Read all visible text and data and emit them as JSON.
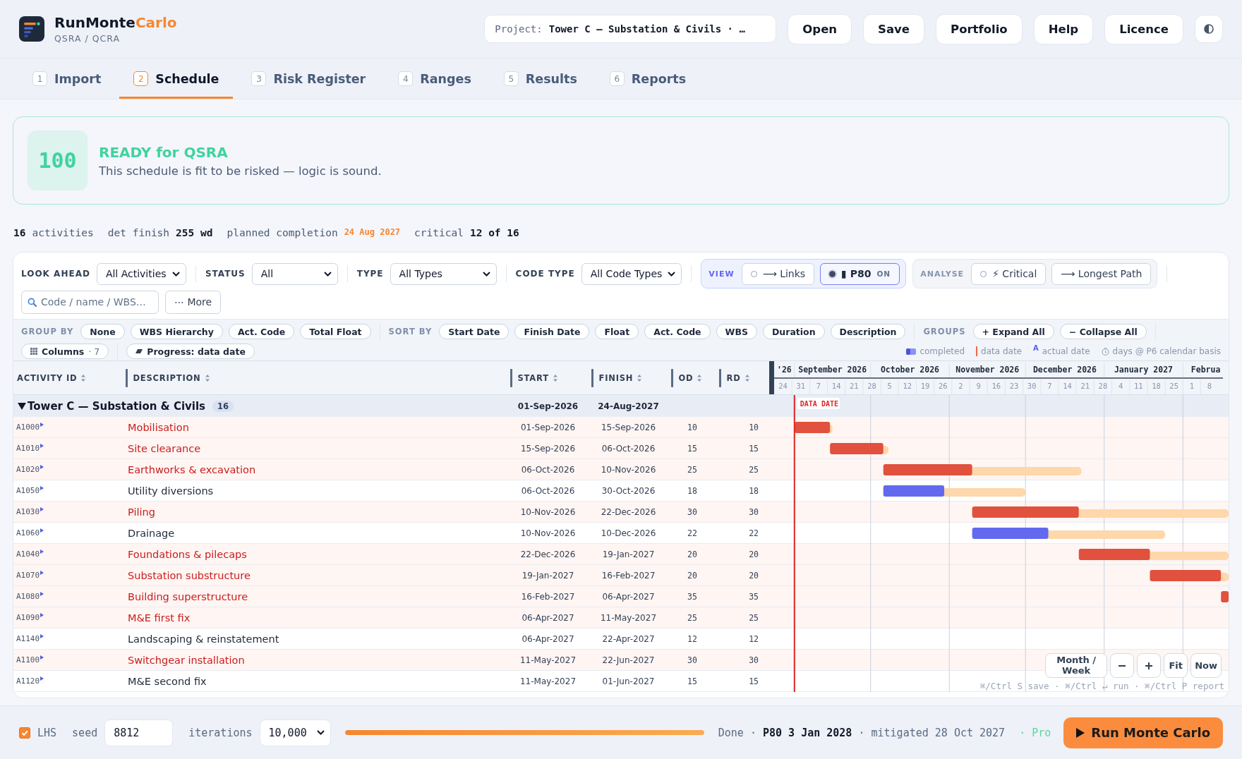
{
  "app": {
    "brand_main": "RunMonte",
    "brand_accent": "Carlo",
    "subtitle": "QSRA / QCRA"
  },
  "project_field": {
    "label": "Project:",
    "value": "Tower C — Substation & Civils · …"
  },
  "header_buttons": [
    "Open",
    "Save",
    "Portfolio",
    "Help",
    "Licence"
  ],
  "tabs": [
    {
      "number": "1",
      "label": "Import",
      "selected": false
    },
    {
      "number": "2",
      "label": "Schedule",
      "selected": true
    },
    {
      "number": "3",
      "label": "Risk Register",
      "selected": false
    },
    {
      "number": "4",
      "label": "Ranges",
      "selected": false
    },
    {
      "number": "5",
      "label": "Results",
      "selected": false
    },
    {
      "number": "6",
      "label": "Reports",
      "selected": false
    }
  ],
  "readiness": {
    "score": "100",
    "title": "READY for QSRA",
    "message": "This schedule is fit to be risked — logic is sound."
  },
  "summary": [
    {
      "kind": "count",
      "value": "16",
      "label": "activities"
    },
    {
      "kind": "metric",
      "label": "det finish",
      "value": "255 wd"
    },
    {
      "kind": "date",
      "label": "planned completion",
      "value": "24 Aug 2027"
    },
    {
      "kind": "metric",
      "label": "critical",
      "value": "12 of 16"
    }
  ],
  "filters": [
    {
      "label": "LOOK AHEAD",
      "value": "All Activities"
    },
    {
      "label": "STATUS",
      "value": "All"
    },
    {
      "label": "TYPE",
      "value": "All Types"
    },
    {
      "label": "CODE TYPE",
      "value": "All Code Types"
    }
  ],
  "view": {
    "label": "VIEW",
    "toggles": [
      {
        "kind": "toggle",
        "label": "⟶ Links",
        "on": false
      },
      {
        "kind": "toggle",
        "label": "▮ P80",
        "on": true,
        "badge": "ON"
      }
    ]
  },
  "analyse": {
    "label": "ANALYSE",
    "toggles": [
      {
        "kind": "toggle",
        "label": "⚡ Critical",
        "on": false
      },
      {
        "kind": "action",
        "label": "⟶ Longest Path"
      }
    ]
  },
  "search": {
    "placeholder": "Code / name / WBS…"
  },
  "more_button": "⋯ More",
  "group_by": {
    "label": "GROUP BY",
    "options": [
      "None",
      "WBS Hierarchy",
      "Act. Code",
      "Total Float"
    ]
  },
  "sort_by": {
    "label": "SORT BY",
    "options": [
      "Start Date",
      "Finish Date",
      "Float",
      "Act. Code",
      "WBS",
      "Duration",
      "Description"
    ]
  },
  "groups": {
    "label": "GROUPS",
    "actions": [
      "+ Expand All",
      "− Collapse All"
    ]
  },
  "columns_button": {
    "label": "Columns",
    "count": "· 7"
  },
  "progress_button": {
    "label": "Progress: data date"
  },
  "legend": [
    {
      "kind": "completed",
      "label": "completed"
    },
    {
      "kind": "data_date",
      "label": "data date"
    },
    {
      "kind": "actual",
      "symbol": "A",
      "label": "actual date"
    },
    {
      "kind": "calendar",
      "label": "days @ P6 calendar basis"
    }
  ],
  "table": {
    "columns": [
      "ACTIVITY ID",
      "DESCRIPTION",
      "START",
      "FINISH",
      "OD",
      "RD"
    ],
    "group": {
      "name": "Tower C — Substation & Civils",
      "count": "16",
      "start": "01-Sep-2026",
      "finish": "24-Aug-2027",
      "expanded": true
    },
    "rows": [
      {
        "id": "A1000",
        "description": "Mobilisation",
        "start": "01-Sep-2026",
        "finish": "15-Sep-2026",
        "od": "10",
        "rd": "10",
        "critical": true
      },
      {
        "id": "A1010",
        "description": "Site clearance",
        "start": "15-Sep-2026",
        "finish": "06-Oct-2026",
        "od": "15",
        "rd": "15",
        "critical": true
      },
      {
        "id": "A1020",
        "description": "Earthworks & excavation",
        "start": "06-Oct-2026",
        "finish": "10-Nov-2026",
        "od": "25",
        "rd": "25",
        "critical": true
      },
      {
        "id": "A1050",
        "description": "Utility diversions",
        "start": "06-Oct-2026",
        "finish": "30-Oct-2026",
        "od": "18",
        "rd": "18",
        "critical": false
      },
      {
        "id": "A1030",
        "description": "Piling",
        "start": "10-Nov-2026",
        "finish": "22-Dec-2026",
        "od": "30",
        "rd": "30",
        "critical": true
      },
      {
        "id": "A1060",
        "description": "Drainage",
        "start": "10-Nov-2026",
        "finish": "10-Dec-2026",
        "od": "22",
        "rd": "22",
        "critical": false
      },
      {
        "id": "A1040",
        "description": "Foundations & pilecaps",
        "start": "22-Dec-2026",
        "finish": "19-Jan-2027",
        "od": "20",
        "rd": "20",
        "critical": true
      },
      {
        "id": "A1070",
        "description": "Substation substructure",
        "start": "19-Jan-2027",
        "finish": "16-Feb-2027",
        "od": "20",
        "rd": "20",
        "critical": true
      },
      {
        "id": "A1080",
        "description": "Building superstructure",
        "start": "16-Feb-2027",
        "finish": "06-Apr-2027",
        "od": "35",
        "rd": "35",
        "critical": true
      },
      {
        "id": "A1090",
        "description": "M&E first fix",
        "start": "06-Apr-2027",
        "finish": "11-May-2027",
        "od": "25",
        "rd": "25",
        "critical": true
      },
      {
        "id": "A1140",
        "description": "Landscaping & reinstatement",
        "start": "06-Apr-2027",
        "finish": "22-Apr-2027",
        "od": "12",
        "rd": "12",
        "critical": false
      },
      {
        "id": "A1100",
        "description": "Switchgear installation",
        "start": "11-May-2027",
        "finish": "22-Jun-2027",
        "od": "30",
        "rd": "30",
        "critical": true
      },
      {
        "id": "A1120",
        "description": "M&E second fix",
        "start": "11-May-2027",
        "finish": "01-Jun-2027",
        "od": "15",
        "rd": "15",
        "critical": false
      }
    ]
  },
  "gantt": {
    "timeline": {
      "months": [
        "'26",
        "September 2026",
        "October 2026",
        "November 2026",
        "December 2026",
        "January 2027",
        "Februa"
      ],
      "weeks": [
        "24",
        "31",
        "7",
        "14",
        "21",
        "28",
        "5",
        "12",
        "19",
        "26",
        "2",
        "9",
        "16",
        "23",
        "30",
        "7",
        "14",
        "21",
        "28",
        "4",
        "11",
        "18",
        "25",
        "1",
        "8"
      ]
    },
    "data_date_label": "DATA DATE",
    "zoom_controls": {
      "scale": "Month / Week",
      "fit": "Fit",
      "now": "Now"
    },
    "shortcuts": "⌘/Ctrl S save · ⌘/Ctrl ↵ run · ⌘/Ctrl P report"
  },
  "simulation": {
    "lhs": {
      "label": "LHS",
      "checked": true
    },
    "seed": {
      "label": "seed",
      "value": "8812"
    },
    "iterations": {
      "label": "iterations",
      "value": "10,000"
    },
    "progress": {
      "level": 1
    },
    "status": "Done · **P80 3 Jan 2028** · mitigated 28 Oct 2027",
    "plan": "· Pro",
    "run_button": "Run Monte Carlo"
  }
}
